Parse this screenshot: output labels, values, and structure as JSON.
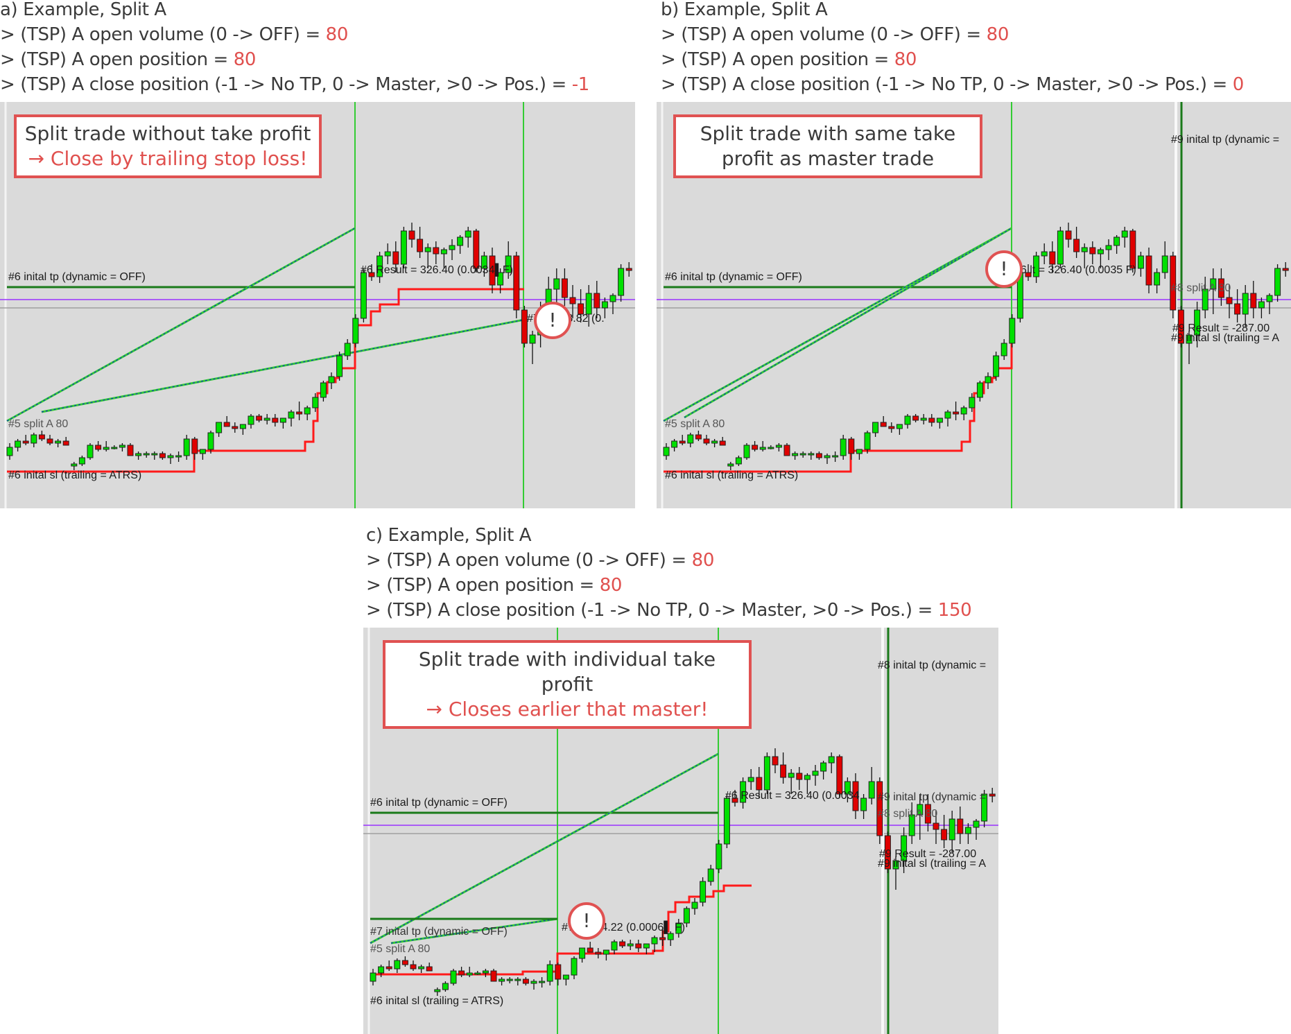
{
  "panels": [
    {
      "id": "a",
      "title": "a) Example, Split A",
      "params": [
        {
          "label": "> (TSP) A open volume (0 -> OFF) = ",
          "value": "80"
        },
        {
          "label": "> (TSP) A open position = ",
          "value": "80"
        },
        {
          "label": "> (TSP) A close position (-1 -> No TP, 0 -> Master, >0 -> Pos.) = ",
          "value": "-1"
        }
      ],
      "callout": {
        "line1": "Split trade without take profit",
        "line2": "→ Close by trailing stop loss!"
      },
      "chart_labels": {
        "tp": "#6 inital tp (dynamic = OFF)",
        "result_master": "#6 Result = 326.40 (0.0034▌F)",
        "result_split": "#7   lt = 68.82 (0.",
        "split": "#5 split A 80",
        "sl": "#6 inital sl (trailing = ATRS)"
      },
      "alert_icon": "!"
    },
    {
      "id": "b",
      "title": "b) Example, Split A",
      "params": [
        {
          "label": "> (TSP) A open volume (0 -> OFF) = ",
          "value": "80"
        },
        {
          "label": "> (TSP) A open position = ",
          "value": "80"
        },
        {
          "label": "> (TSP) A close position (-1 -> No TP, 0 -> Master, >0 -> Pos.) = ",
          "value": "0"
        }
      ],
      "callout": {
        "line1": "Split trade with same take",
        "line2": "profit as master trade"
      },
      "chart_labels": {
        "tp": "#6 inital tp (dynamic = OFF)",
        "tp2": "#9 inital tp (dynamic =",
        "result_master": "#6   lt = 326.40 (0.0035 F)",
        "split": "#5 split A 80",
        "split2": "#8 split A 80",
        "result_loss": "#9 Result = -287.00",
        "sl": "#6 inital sl (trailing = ATRS)",
        "sl2": "#9 inital sl (trailing = A"
      },
      "alert_icon": "!"
    },
    {
      "id": "c",
      "title": "c) Example, Split A",
      "params": [
        {
          "label": "> (TSP) A open volume (0 -> OFF) = ",
          "value": "80"
        },
        {
          "label": "> (TSP) A open position = ",
          "value": "80"
        },
        {
          "label": "> (TSP) A close position (-1 -> No TP, 0 -> Master, >0 -> Pos.) = ",
          "value": "150"
        }
      ],
      "callout": {
        "line1": "Split trade with individual take profit",
        "line2": "→ Closes earlier that master!"
      },
      "chart_labels": {
        "tp": "#6 inital tp (dynamic = OFF)",
        "tp_split": "#7 inital tp (dynamic = OFF)",
        "tp2": "#8 inital tp (dynamic =",
        "tp3": "#9 inital tp (dynamic =",
        "result_master": "#6 Result = 326.40 (0.0034",
        "result_split": "#7   lt = 14.22 (0.0006▌ F)",
        "split": "#5 split A 80",
        "split2": "#8 split A 80",
        "result_loss": "#9 Result = -287.00",
        "sl": "#6 inital sl (trailing = ATRS)",
        "sl2": "#9 inital sl (trailing = A"
      },
      "alert_icon": "!"
    }
  ],
  "colors": {
    "accent_red": "#e0504e",
    "bull": "#00e000",
    "bear": "#e00000",
    "tp_line": "#1a7a1a",
    "sl_line": "#ff1a1a",
    "price_line": "#9933ff",
    "marker_line": "#33cc33",
    "chart_bg": "#dadada"
  },
  "chart_data": {
    "type": "candlestick",
    "note": "Relative price series (arbitrary units, higher = higher price) shared by all three panels",
    "candles": [
      [
        60,
        66,
        58,
        64
      ],
      [
        64,
        68,
        62,
        67
      ],
      [
        67,
        70,
        65,
        66
      ],
      [
        66,
        71,
        64,
        70
      ],
      [
        70,
        72,
        67,
        68
      ],
      [
        68,
        70,
        65,
        66
      ],
      [
        66,
        68,
        64,
        67
      ],
      [
        67,
        69,
        65,
        65
      ],
      [
        55,
        57,
        53,
        56
      ],
      [
        56,
        60,
        55,
        59
      ],
      [
        59,
        66,
        58,
        65
      ],
      [
        65,
        67,
        62,
        63
      ],
      [
        63,
        67,
        62,
        64
      ],
      [
        64,
        65,
        63,
        64
      ],
      [
        64,
        66,
        62,
        65
      ],
      [
        65,
        66,
        62,
        60
      ],
      [
        60,
        62,
        58,
        61
      ],
      [
        61,
        62,
        59,
        61
      ],
      [
        61,
        62,
        58,
        61
      ],
      [
        61,
        62,
        58,
        59
      ],
      [
        59,
        61,
        56,
        60
      ],
      [
        60,
        62,
        57,
        60
      ],
      [
        60,
        70,
        58,
        68
      ],
      [
        68,
        69,
        58,
        61
      ],
      [
        61,
        63,
        58,
        63
      ],
      [
        63,
        72,
        61,
        71
      ],
      [
        71,
        76,
        69,
        76
      ],
      [
        76,
        79,
        74,
        74
      ],
      [
        74,
        76,
        71,
        73
      ],
      [
        73,
        75,
        70,
        75
      ],
      [
        75,
        80,
        73,
        79
      ],
      [
        79,
        80,
        76,
        77
      ],
      [
        77,
        80,
        75,
        78
      ],
      [
        78,
        80,
        74,
        76
      ],
      [
        76,
        78,
        73,
        78
      ],
      [
        78,
        82,
        74,
        81
      ],
      [
        81,
        86,
        77,
        80
      ],
      [
        80,
        84,
        77,
        83
      ],
      [
        83,
        90,
        81,
        88
      ],
      [
        88,
        96,
        86,
        95
      ],
      [
        95,
        100,
        92,
        98
      ],
      [
        98,
        110,
        96,
        108
      ],
      [
        108,
        116,
        106,
        114
      ],
      [
        114,
        128,
        112,
        126
      ],
      [
        126,
        150,
        124,
        148
      ],
      [
        148,
        152,
        144,
        146
      ],
      [
        146,
        158,
        143,
        156
      ],
      [
        156,
        162,
        152,
        158
      ],
      [
        158,
        163,
        148,
        152
      ],
      [
        152,
        170,
        150,
        168
      ],
      [
        168,
        172,
        160,
        164
      ],
      [
        164,
        170,
        155,
        158
      ],
      [
        158,
        162,
        150,
        160
      ],
      [
        160,
        163,
        152,
        157
      ],
      [
        157,
        160,
        150,
        159
      ],
      [
        159,
        164,
        154,
        161
      ],
      [
        161,
        166,
        157,
        165
      ],
      [
        165,
        170,
        160,
        168
      ],
      [
        168,
        169,
        148,
        150
      ],
      [
        150,
        158,
        146,
        156
      ],
      [
        156,
        160,
        138,
        142
      ],
      [
        142,
        150,
        138,
        148
      ],
      [
        148,
        163,
        145,
        156
      ],
      [
        156,
        158,
        126,
        130
      ],
      [
        130,
        132,
        112,
        114
      ],
      [
        114,
        120,
        104,
        118
      ],
      [
        118,
        134,
        112,
        130
      ],
      [
        130,
        146,
        126,
        140
      ],
      [
        140,
        150,
        128,
        145
      ],
      [
        145,
        150,
        132,
        136
      ],
      [
        136,
        142,
        126,
        133
      ],
      [
        133,
        140,
        124,
        128
      ],
      [
        128,
        142,
        122,
        138
      ],
      [
        138,
        144,
        126,
        131
      ],
      [
        131,
        136,
        126,
        134
      ],
      [
        134,
        138,
        128,
        137
      ],
      [
        137,
        152,
        134,
        150
      ],
      [
        150,
        153,
        146,
        149
      ],
      [
        149,
        152,
        144,
        150
      ]
    ]
  }
}
